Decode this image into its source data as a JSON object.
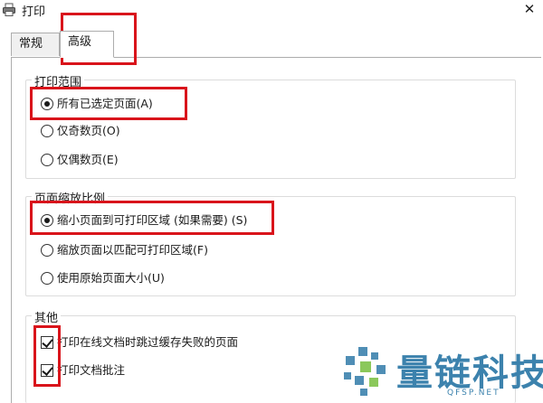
{
  "window": {
    "title": "打印",
    "close_glyph": "✕"
  },
  "tabs": [
    {
      "label": "常规",
      "selected": false
    },
    {
      "label": "高级",
      "selected": true
    }
  ],
  "groups": {
    "range": {
      "title": "打印范围",
      "options": [
        {
          "label": "所有已选定页面(A)",
          "checked": true
        },
        {
          "label": "仅奇数页(O)",
          "checked": false
        },
        {
          "label": "仅偶数页(E)",
          "checked": false
        }
      ]
    },
    "scale": {
      "title": "页面缩放比例",
      "options": [
        {
          "label": "缩小页面到可打印区域 (如果需要) (S)",
          "checked": true
        },
        {
          "label": "缩放页面以匹配可打印区域(F)",
          "checked": false
        },
        {
          "label": "使用原始页面大小(U)",
          "checked": false
        }
      ]
    },
    "other": {
      "title": "其他",
      "options": [
        {
          "label": "打印在线文档时跳过缓存失败的页面",
          "checked": true
        },
        {
          "label": "打印文档批注",
          "checked": true
        }
      ]
    }
  },
  "watermark": {
    "brand": "量链科技",
    "site": "QFSP.NET"
  },
  "colors": {
    "highlight": "#d9141b",
    "watermark": "#3c82ad"
  }
}
